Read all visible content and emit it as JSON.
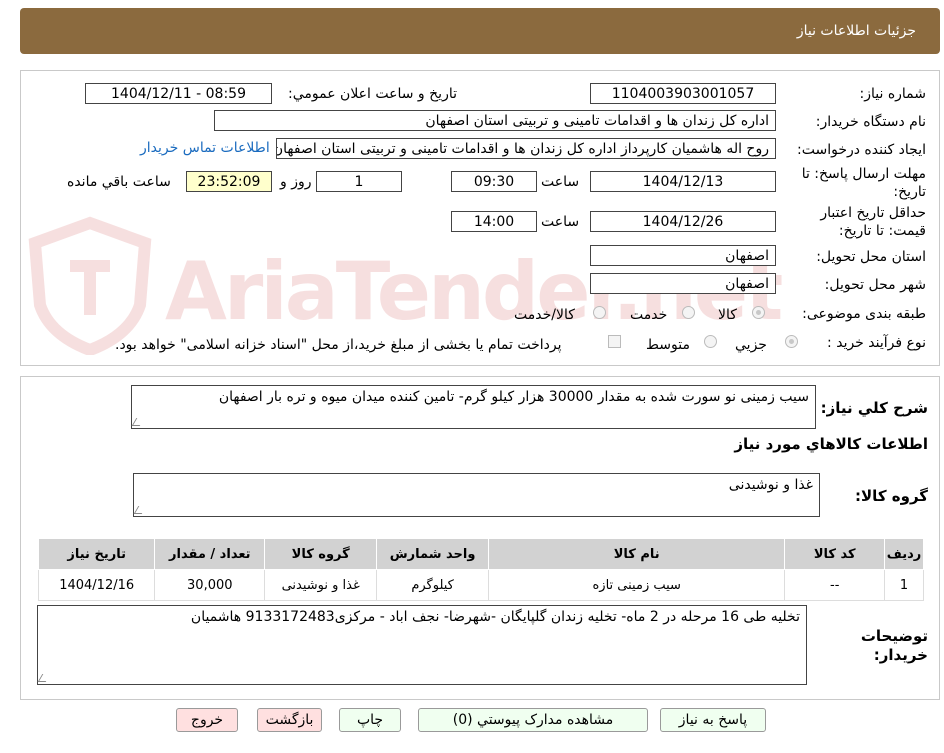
{
  "header": {
    "title": "جزئیات اطلاعات نیاز"
  },
  "form": {
    "need_number_label": "شماره نیاز:",
    "need_number": "1104003903001057",
    "announce_label": "تاریخ و ساعت اعلان عمومي:",
    "announce_value": "1404/12/11 - 08:59",
    "buyer_org_label": "نام دستگاه خريدار:",
    "buyer_org": "اداره کل زندان ها و اقدامات تامینی و تربیتی استان اصفهان",
    "requester_label": "ايجاد کننده درخواست:",
    "requester": "روح اله هاشمیان کارپرداز اداره کل زندان ها و اقدامات تامینی و تربیتی استان اصفهان",
    "contact_link": "اطلاعات تماس خريدار",
    "deadline_label_1": "مهلت ارسال پاسخ: تا",
    "deadline_label_2": "تاريخ:",
    "deadline_date": "1404/12/13",
    "time_label": "ساعت",
    "deadline_time": "09:30",
    "days_value": "1",
    "days_label": "روز و",
    "remaining_time": "23:52:09",
    "remaining_label": "ساعت باقي مانده",
    "validity_label_1": "حداقل تاريخ اعتبار",
    "validity_label_2": "قيمت: تا تاريخ:",
    "validity_date": "1404/12/26",
    "validity_time": "14:00",
    "province_label": "استان محل تحويل:",
    "province": "اصفهان",
    "city_label": "شهر محل تحويل:",
    "city": "اصفهان",
    "category_label": "طبقه بندی موضوعی:",
    "category_options": [
      "کالا",
      "خدمت",
      "کالا/خدمت"
    ],
    "process_label": "نوع فرآيند خريد :",
    "process_options": [
      "جزيي",
      "متوسط"
    ],
    "payment_note": "پرداخت تمام يا بخشی از مبلغ خريد،از محل \"اسناد خزانه اسلامی\" خواهد بود."
  },
  "description": {
    "label": "شرح کلي نياز:",
    "text": "سیب زمینی نو سورت شده به مقدار 30000 هزار کیلو گرم- تامین کننده میدان میوه و تره بار اصفهان"
  },
  "goods": {
    "section_title": "اطلاعات کالاهاي مورد نياز",
    "group_label": "گروه کالا:",
    "group_value": "غذا و نوشیدنی",
    "columns": [
      "رديف",
      "کد کالا",
      "نام کالا",
      "واحد شمارش",
      "گروه کالا",
      "تعداد / مقدار",
      "تاريخ نياز"
    ],
    "rows": [
      [
        "1",
        "--",
        "سیب زمینی تازه",
        "کیلوگرم",
        "غذا و نوشیدنی",
        "30,000",
        "1404/12/16"
      ]
    ]
  },
  "buyer_notes": {
    "label_1": "توضيحات",
    "label_2": "خريدار:",
    "text": "تخلیه طی 16 مرحله در 2 ماه- تخلیه زندان گلپایگان -شهرضا-  نجف اباد - مرکزی9133172483 هاشمیان"
  },
  "buttons": {
    "reply": "پاسخ به نياز",
    "attachments": "مشاهده مدارک پيوستي (0)",
    "print": "چاپ",
    "back": "بازگشت",
    "exit": "خروج"
  },
  "watermark": {
    "text": "AriaTender.net"
  },
  "colors": {
    "header_bg": "#8b6a3e",
    "time_bg": "#ffffcc",
    "table_header": "#d2d2d2",
    "button_green": "#f0fff0",
    "button_red": "#ffe0e0"
  }
}
